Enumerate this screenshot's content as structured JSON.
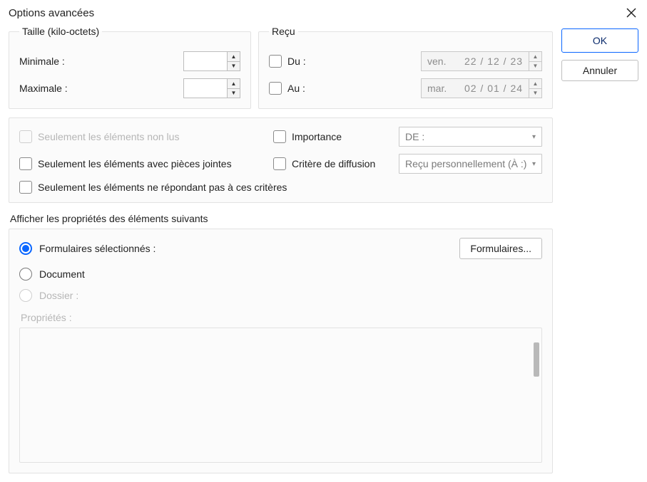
{
  "window": {
    "title": "Options avancées"
  },
  "buttons": {
    "ok": "OK",
    "cancel": "Annuler",
    "forms": "Formulaires..."
  },
  "size": {
    "legend": "Taille (kilo-octets)",
    "min_label": "Minimale :",
    "max_label": "Maximale :",
    "min_value": "",
    "max_value": ""
  },
  "received": {
    "legend": "Reçu",
    "from_label": "Du :",
    "to_label": "Au :",
    "from_day": "ven.",
    "from_date": "22 / 12 / 23",
    "to_day": "mar.",
    "to_date": "02 / 01 / 24"
  },
  "filters": {
    "unread": "Seulement les éléments non lus",
    "attachments": "Seulement les éléments avec pièces jointes",
    "not_matching": "Seulement les éléments ne répondant pas à ces critères",
    "importance": "Importance",
    "importance_value": "DE :",
    "distribution": "Critère de diffusion",
    "distribution_value": "Reçu personnellement (À :)"
  },
  "props": {
    "section_title": "Afficher les propriétés des éléments suivants",
    "selected_forms": "Formulaires sélectionnés :",
    "document": "Document",
    "folder": "Dossier :",
    "properties_label": "Propriétés :"
  }
}
